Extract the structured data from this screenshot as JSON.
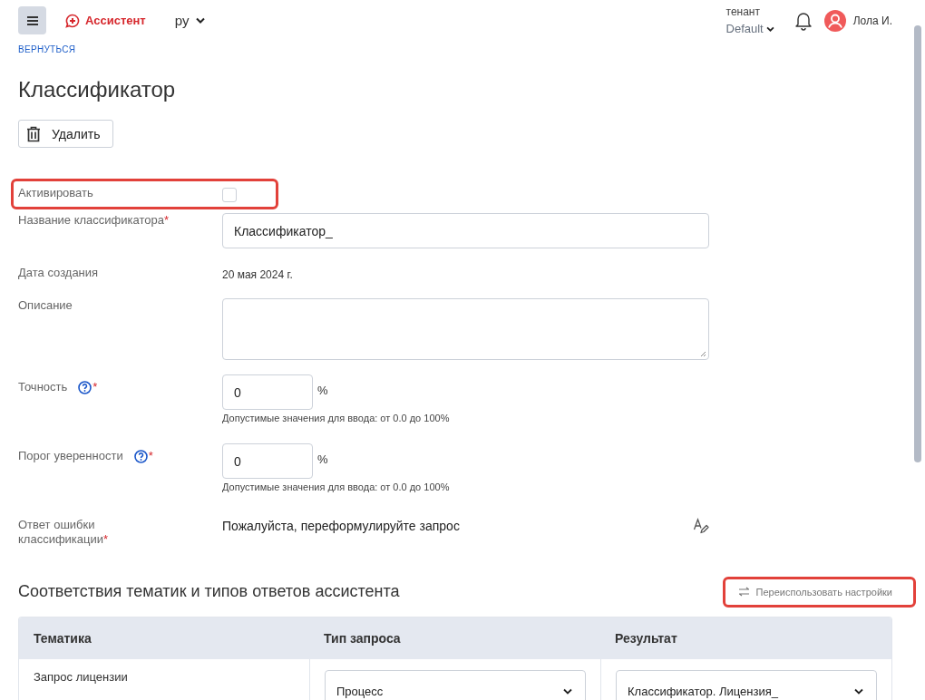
{
  "header": {
    "app_name": "Ассистент",
    "language": "ру",
    "tenant_label": "тенант",
    "tenant": "Default",
    "user": "Лола И."
  },
  "back_link": "ВЕРНУТЬСЯ",
  "title": "Классификатор",
  "delete_button": "Удалить",
  "fields": [
    {
      "kind": "checkbox",
      "label": "Активировать",
      "help": false,
      "checked": false,
      "highlighted": true
    },
    {
      "kind": "text",
      "label": "Название классификатора",
      "required_mark": "*",
      "help": false,
      "value": "Классификатор_"
    },
    {
      "kind": "static",
      "label": "Дата создания",
      "help": false,
      "value": "20 мая 2024 г."
    },
    {
      "kind": "textarea",
      "label": "Описание",
      "help": false
    },
    {
      "kind": "percent",
      "label": "Точность",
      "help": true,
      "required_mark": "*",
      "value": "0",
      "unit": "%",
      "hint": "Допустимые значения для ввода: от 0.0 до 100%"
    },
    {
      "kind": "percent",
      "label": "Порог уверенности",
      "help": true,
      "required_mark": "*",
      "value": "0",
      "unit": "%",
      "hint": "Допустимые значения для ввода: от 0.0 до 100%"
    },
    {
      "kind": "editable_text",
      "label": "Ответ ошибки классификации",
      "required_mark": "*",
      "help": false,
      "value": "Пожалуйста, переформулируйте запрос"
    }
  ],
  "section": {
    "title": "Соответствия тематик и типов ответов ассистента",
    "reuse_button": {
      "label": "Переиспользовать настройки",
      "highlighted": true
    }
  },
  "table": {
    "columns": [
      "Тематика",
      "Тип запроса",
      "Результат"
    ],
    "rows": [
      {
        "topic": "Запрос лицензии",
        "request_type": "Процесс",
        "result": "Классификатор. Лицензия_"
      }
    ]
  }
}
